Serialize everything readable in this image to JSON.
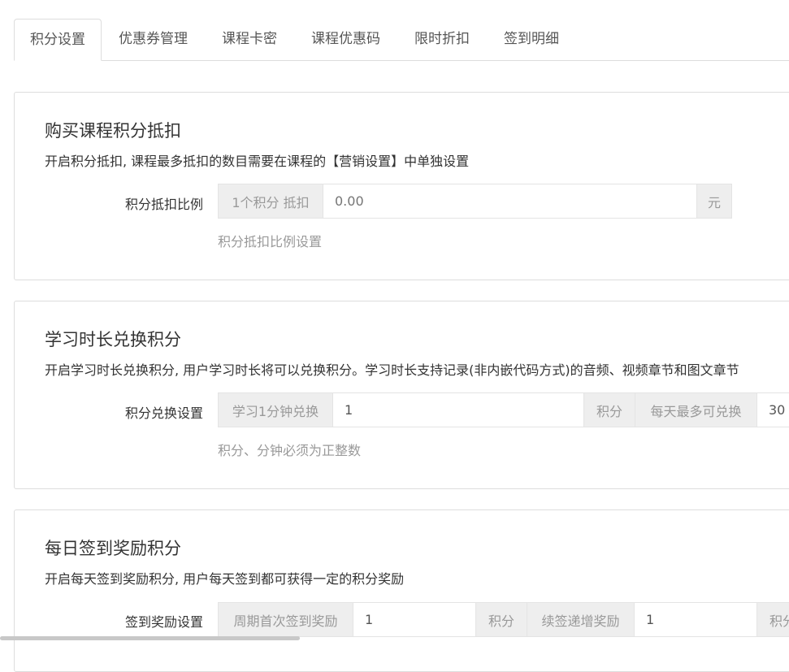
{
  "tabs": [
    {
      "label": "积分设置",
      "active": true
    },
    {
      "label": "优惠券管理"
    },
    {
      "label": "课程卡密"
    },
    {
      "label": "课程优惠码"
    },
    {
      "label": "限时折扣"
    },
    {
      "label": "签到明细"
    }
  ],
  "deduct": {
    "title": "购买课程积分抵扣",
    "desc": "开启积分抵扣, 课程最多抵扣的数目需要在课程的【营销设置】中单独设置",
    "label": "积分抵扣比例",
    "prefix": "1个积分 抵扣",
    "placeholder": "0.00",
    "suffix": "元",
    "help": "积分抵扣比例设置"
  },
  "exchange": {
    "title": "学习时长兑换积分",
    "desc": "开启学习时长兑换积分, 用户学习时长将可以兑换积分。学习时长支持记录(非内嵌代码方式)的音频、视频章节和图文章节",
    "label": "积分兑换设置",
    "prefix": "学习1分钟兑换",
    "value": "1",
    "unit": "积分",
    "max_label": "每天最多可兑换",
    "max_value": "30",
    "help": "积分、分钟必须为正整数"
  },
  "signin": {
    "title": "每日签到奖励积分",
    "desc": "开启每天签到奖励积分, 用户每天签到都可获得一定的积分奖励",
    "label": "签到奖励设置",
    "first_label": "周期首次签到奖励",
    "first_value": "1",
    "unit": "积分",
    "inc_label": "续签递增奖励",
    "inc_value": "1",
    "unit2": "积分"
  }
}
